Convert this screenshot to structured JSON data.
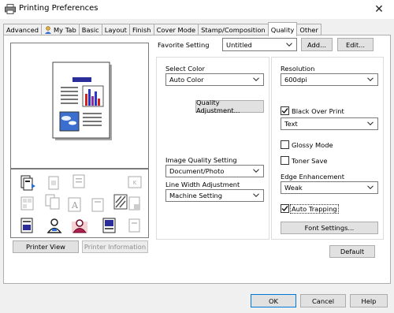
{
  "window": {
    "title": "Printing Preferences",
    "close_glyph": "✕"
  },
  "tabs": [
    "Advanced",
    "My Tab",
    "Basic",
    "Layout",
    "Finish",
    "Cover Mode",
    "Stamp/Composition",
    "Quality",
    "Other"
  ],
  "favorite": {
    "label": "Favorite Setting",
    "value": "Untitled",
    "add_label": "Add...",
    "edit_label": "Edit..."
  },
  "color": {
    "label": "Select Color",
    "value": "Auto Color",
    "quality_adjustment_label": "Quality Adjustment..."
  },
  "image_quality": {
    "label": "Image Quality Setting",
    "value": "Document/Photo"
  },
  "line_width": {
    "label": "Line Width Adjustment",
    "value": "Machine Setting"
  },
  "resolution": {
    "label": "Resolution",
    "value": "600dpi"
  },
  "black_over_print": {
    "label": "Black Over Print",
    "checked": true,
    "value": "Text"
  },
  "glossy_mode": {
    "label": "Glossy Mode",
    "checked": false
  },
  "toner_save": {
    "label": "Toner Save",
    "checked": false
  },
  "edge_enhancement": {
    "label": "Edge Enhancement",
    "value": "Weak"
  },
  "auto_trapping": {
    "label": "Auto Trapping",
    "checked": true
  },
  "font_settings_label": "Font Settings...",
  "default_label": "Default",
  "printer_view_label": "Printer View",
  "printer_information_label": "Printer Information",
  "footer": {
    "ok_label": "OK",
    "cancel_label": "Cancel",
    "help_label": "Help"
  },
  "colors": {
    "accent": "#0078d7",
    "doc_title_bar": "#2a2d9a"
  }
}
